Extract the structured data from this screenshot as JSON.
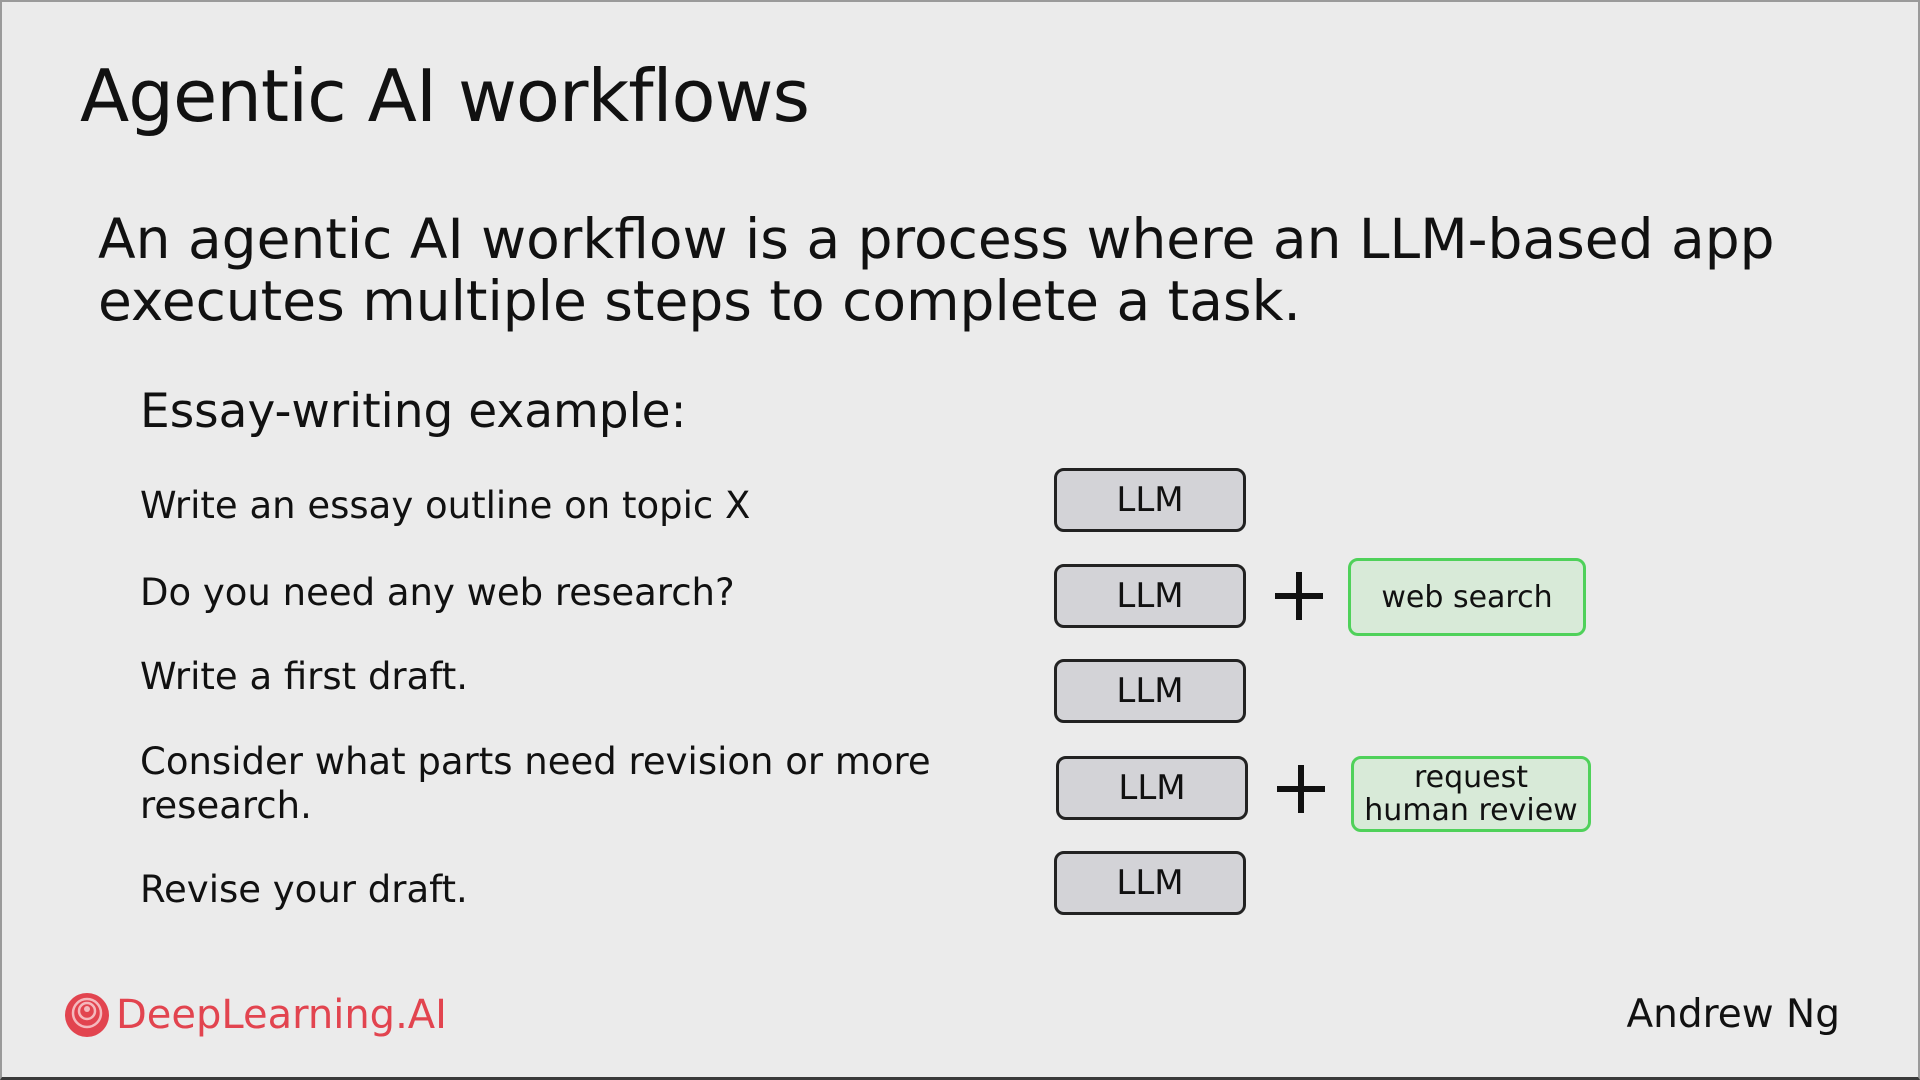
{
  "title": "Agentic AI workflows",
  "definition": {
    "line1": "An agentic AI workflow is a process where an LLM-based app",
    "line2": "executes multiple steps to complete a task."
  },
  "example_heading": "Essay-writing example:",
  "steps": [
    {
      "text": "Write an essay outline on topic X",
      "llm_label": "LLM"
    },
    {
      "text": "Do you need any web research?",
      "llm_label": "LLM",
      "tool": {
        "line1": "web search"
      }
    },
    {
      "text": "Write a first draft.",
      "llm_label": "LLM"
    },
    {
      "text_line1": "Consider what parts need revision or more",
      "text_line2": "research.",
      "llm_label": "LLM",
      "tool": {
        "line1": "request",
        "line2": "human review"
      }
    },
    {
      "text": "Revise your draft.",
      "llm_label": "LLM"
    }
  ],
  "footer": {
    "logo_text": "DeepLearning.AI",
    "author": "Andrew Ng"
  },
  "colors": {
    "background": "#ebebeb",
    "llm_box_fill": "#d3d3d7",
    "tool_border": "#4fd15a",
    "tool_fill": "#d8ead8",
    "brand": "#e2444f"
  },
  "icons": {
    "plus": "plus-icon",
    "logo": "deeplearning-ai-logo-icon"
  }
}
